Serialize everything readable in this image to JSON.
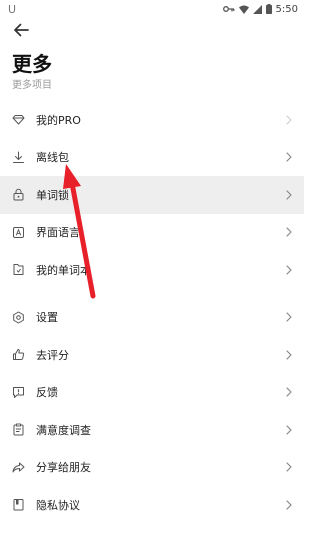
{
  "status_bar": {
    "left_glyph": "U",
    "time": "5:50"
  },
  "header": {
    "title": "更多",
    "subtitle": "更多项目"
  },
  "menu": {
    "group1": [
      {
        "label": "我的PRO",
        "icon": "diamond-icon",
        "name": "pro"
      },
      {
        "label": "离线包",
        "icon": "download-icon",
        "name": "offline-package"
      },
      {
        "label": "单词锁",
        "icon": "lock-icon",
        "name": "word-lock"
      },
      {
        "label": "界面语言",
        "icon": "language-icon",
        "name": "ui-language"
      },
      {
        "label": "我的单词本",
        "icon": "wordbook-icon",
        "name": "wordbook"
      }
    ],
    "group2": [
      {
        "label": "设置",
        "icon": "gear-icon",
        "name": "settings"
      },
      {
        "label": "去评分",
        "icon": "thumbs-up-icon",
        "name": "rate"
      },
      {
        "label": "反馈",
        "icon": "feedback-icon",
        "name": "feedback"
      },
      {
        "label": "满意度调查",
        "icon": "survey-icon",
        "name": "survey"
      },
      {
        "label": "分享给朋友",
        "icon": "share-icon",
        "name": "share"
      },
      {
        "label": "隐私协议",
        "icon": "privacy-icon",
        "name": "privacy"
      }
    ]
  },
  "colors": {
    "highlight_row": "#eeeeee",
    "annotation_arrow": "#e8202a"
  }
}
